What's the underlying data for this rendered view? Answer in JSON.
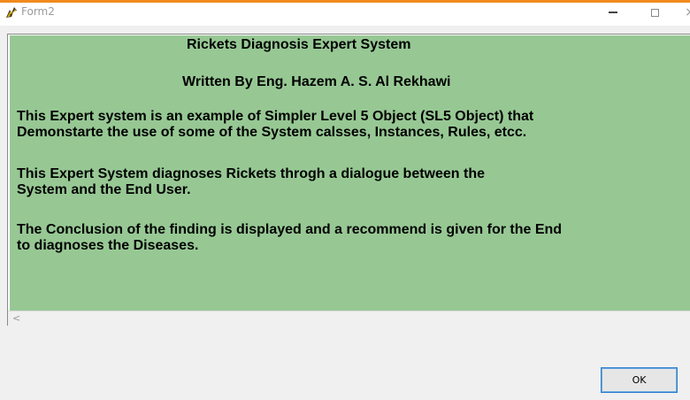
{
  "window": {
    "title": "Form2",
    "close_glyph": "×",
    "icons": [
      "app-icon",
      "minimize-icon",
      "maximize-icon",
      "close-icon"
    ]
  },
  "content": {
    "heading": "Rickets Diagnosis Expert System",
    "author": "Written By Eng. Hazem A. S. Al Rekhawi",
    "para1_line1": "This Expert system is an example of Simpler Level 5 Object (SL5 Object) that",
    "para1_line2": "Demonstarte the use of some of the System calsses, Instances, Rules, etcc.",
    "para2_line1": "This Expert System diagnoses Rickets throgh a dialogue between the",
    "para2_line2": "System and the End User.",
    "para3_line1": "The Conclusion of the finding is displayed and a recommend is given for the End",
    "para3_line2": "to diagnoses the Diseases."
  },
  "scrollbar": {
    "left_arrow": "<"
  },
  "buttons": {
    "ok_label": "OK"
  },
  "colors": {
    "panel_green": "#97c894",
    "accent_orange": "#f28a1c",
    "button_focus_border": "#2d7fd1"
  }
}
